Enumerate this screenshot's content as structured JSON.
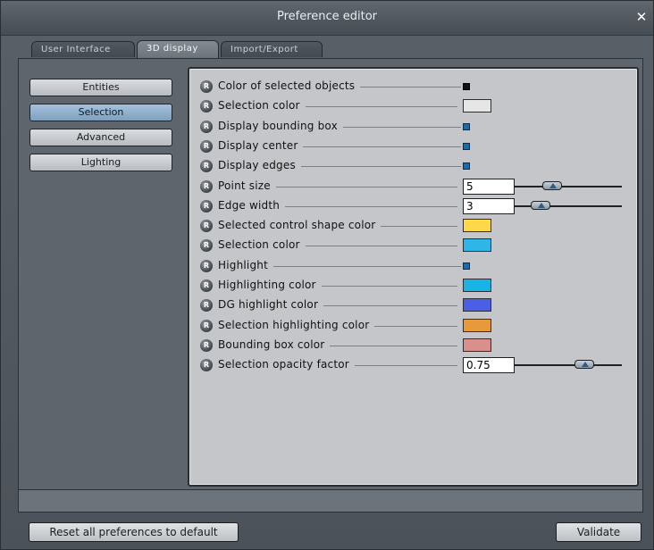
{
  "window": {
    "title": "Preference editor"
  },
  "tabs": [
    {
      "label": "User Interface"
    },
    {
      "label": "3D display"
    },
    {
      "label": "Import/Export"
    }
  ],
  "categories": [
    {
      "label": "Entities",
      "selected": false
    },
    {
      "label": "Selection",
      "selected": true
    },
    {
      "label": "Advanced",
      "selected": false
    },
    {
      "label": "Lighting",
      "selected": false
    }
  ],
  "settings": [
    {
      "reset": "R",
      "label": "Color of selected objects",
      "control": "checkbox",
      "checked": true,
      "style": "black"
    },
    {
      "reset": "R",
      "label": "Selection color",
      "control": "color",
      "color": "#e6e6e6"
    },
    {
      "reset": "R",
      "label": "Display bounding box",
      "control": "checkbox",
      "checked": true
    },
    {
      "reset": "R",
      "label": "Display center",
      "control": "checkbox",
      "checked": true
    },
    {
      "reset": "R",
      "label": "Display edges",
      "control": "checkbox",
      "checked": true
    },
    {
      "reset": "R",
      "label": "Point size",
      "control": "slider",
      "value": "5",
      "level": 0.32
    },
    {
      "reset": "R",
      "label": "Edge width",
      "control": "slider",
      "value": "3",
      "level": 0.18
    },
    {
      "reset": "R",
      "label": "Selected control shape color",
      "control": "color",
      "color": "#ffd84a"
    },
    {
      "reset": "R",
      "label": "Selection color",
      "control": "color",
      "color": "#2fb6e8"
    },
    {
      "reset": "R",
      "label": "Highlight",
      "control": "checkbox",
      "checked": true
    },
    {
      "reset": "R",
      "label": "Highlighting color",
      "control": "color",
      "color": "#19b4e6"
    },
    {
      "reset": "R",
      "label": "DG highlight color",
      "control": "color",
      "color": "#4a5ee6"
    },
    {
      "reset": "R",
      "label": "Selection highlighting color",
      "control": "color",
      "color": "#e89a3a"
    },
    {
      "reset": "R",
      "label": "Bounding box color",
      "control": "color",
      "color": "#d98f8c"
    },
    {
      "reset": "R",
      "label": "Selection opacity factor",
      "control": "slider",
      "value": "0.75",
      "level": 0.68
    }
  ],
  "footer": {
    "reset_label": "Reset all preferences to default",
    "validate_label": "Validate"
  }
}
